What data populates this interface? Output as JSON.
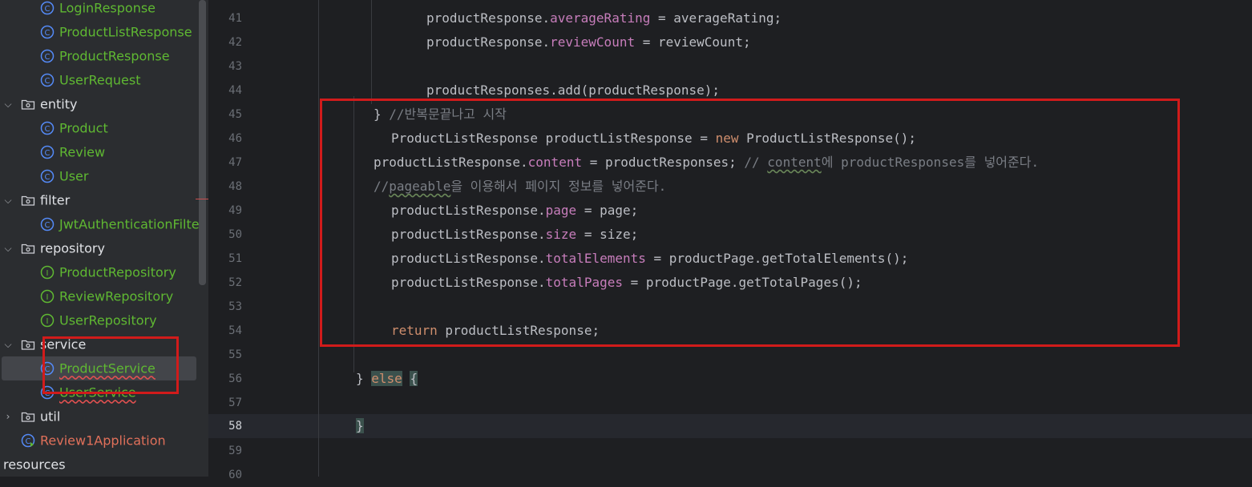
{
  "sidebar": {
    "items": [
      {
        "label": "LoginResponse",
        "kind": "class"
      },
      {
        "label": "ProductListResponse",
        "kind": "class"
      },
      {
        "label": "ProductResponse",
        "kind": "class"
      },
      {
        "label": "UserRequest",
        "kind": "class"
      },
      {
        "label": "entity",
        "kind": "package"
      },
      {
        "label": "Product",
        "kind": "class"
      },
      {
        "label": "Review",
        "kind": "class"
      },
      {
        "label": "User",
        "kind": "class"
      },
      {
        "label": "filter",
        "kind": "package"
      },
      {
        "label": "JwtAuthenticationFilter",
        "kind": "class"
      },
      {
        "label": "repository",
        "kind": "package"
      },
      {
        "label": "ProductRepository",
        "kind": "interface"
      },
      {
        "label": "ReviewRepository",
        "kind": "interface"
      },
      {
        "label": "UserRepository",
        "kind": "interface"
      },
      {
        "label": "service",
        "kind": "package"
      },
      {
        "label": "ProductService",
        "kind": "class",
        "selected": true
      },
      {
        "label": "UserService",
        "kind": "class"
      },
      {
        "label": "util",
        "kind": "package"
      },
      {
        "label": "Review1Application",
        "kind": "app"
      },
      {
        "label": "resources",
        "kind": "folder"
      }
    ]
  },
  "editor": {
    "line_numbers": [
      "41",
      "42",
      "43",
      "44",
      "45",
      "46",
      "47",
      "48",
      "49",
      "50",
      "51",
      "52",
      "53",
      "54",
      "55",
      "56",
      "57",
      "58",
      "59",
      "60"
    ],
    "current_line": "58",
    "lines": {
      "l41": {
        "obj": "productResponse.",
        "field": "averageRating",
        "rest": " = averageRating;"
      },
      "l42": {
        "obj": "productResponse.",
        "field": "reviewCount",
        "rest": " = reviewCount;"
      },
      "l44": {
        "text": "productResponses.add(productResponse);"
      },
      "l45": {
        "brace": "} ",
        "comment": "//반복문끝나고 시작"
      },
      "l46": {
        "a": "ProductListResponse productListResponse = ",
        "kw": "new",
        "b": " ProductListResponse();"
      },
      "l47": {
        "obj": "productListResponse.",
        "field": "content",
        "rest": " = productResponses; ",
        "c1": "// ",
        "c2": "content",
        "c3": "에 productResponses를 넣어준다."
      },
      "l48": {
        "c1": "//",
        "c2": "pageable",
        "c3": "을 이용해서 페이지 정보를 넣어준다."
      },
      "l49": {
        "obj": "productListResponse.",
        "field": "page",
        "rest": " = page;"
      },
      "l50": {
        "obj": "productListResponse.",
        "field": "size",
        "rest": " = size;"
      },
      "l51": {
        "obj": "productListResponse.",
        "field": "totalElements",
        "rest": " = productPage.getTotalElements();"
      },
      "l52": {
        "obj": "productListResponse.",
        "field": "totalPages",
        "rest": " = productPage.getTotalPages();"
      },
      "l54": {
        "kw": "return",
        "rest": " productListResponse;"
      },
      "l56": {
        "brace": "}",
        "kw": "else",
        "open": "{"
      },
      "l58": {
        "brace": "}"
      }
    }
  },
  "colors": {
    "highlight_box": "#d11b1b",
    "class_label": "#5fb832",
    "keyword": "#cf8e6d",
    "field": "#c77dbb",
    "comment": "#7a7e85"
  }
}
